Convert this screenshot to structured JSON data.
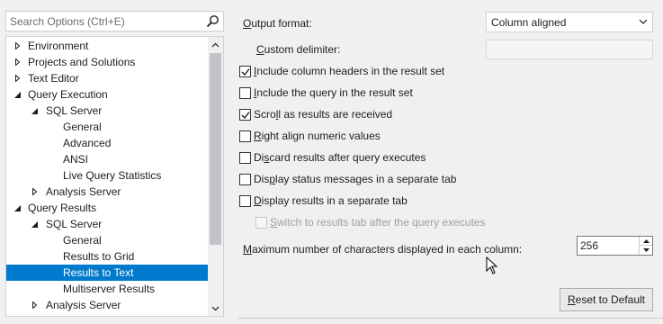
{
  "search": {
    "placeholder": "Search Options (Ctrl+E)"
  },
  "tree": [
    {
      "label": "Environment",
      "state": "collapsed",
      "level": 0,
      "selected": false
    },
    {
      "label": "Projects and Solutions",
      "state": "collapsed",
      "level": 0,
      "selected": false
    },
    {
      "label": "Text Editor",
      "state": "collapsed",
      "level": 0,
      "selected": false
    },
    {
      "label": "Query Execution",
      "state": "expanded",
      "level": 0,
      "selected": false
    },
    {
      "label": "SQL Server",
      "state": "expanded",
      "level": 1,
      "selected": false
    },
    {
      "label": "General",
      "state": "leaf",
      "level": 2,
      "selected": false
    },
    {
      "label": "Advanced",
      "state": "leaf",
      "level": 2,
      "selected": false
    },
    {
      "label": "ANSI",
      "state": "leaf",
      "level": 2,
      "selected": false
    },
    {
      "label": "Live Query Statistics",
      "state": "leaf",
      "level": 2,
      "selected": false
    },
    {
      "label": "Analysis Server",
      "state": "collapsed",
      "level": 1,
      "selected": false
    },
    {
      "label": "Query Results",
      "state": "expanded",
      "level": 0,
      "selected": false
    },
    {
      "label": "SQL Server",
      "state": "expanded",
      "level": 1,
      "selected": false
    },
    {
      "label": "General",
      "state": "leaf",
      "level": 2,
      "selected": false
    },
    {
      "label": "Results to Grid",
      "state": "leaf",
      "level": 2,
      "selected": false
    },
    {
      "label": "Results to Text",
      "state": "leaf",
      "level": 2,
      "selected": true
    },
    {
      "label": "Multiserver Results",
      "state": "leaf",
      "level": 2,
      "selected": false
    },
    {
      "label": "Analysis Server",
      "state": "collapsed",
      "level": 1,
      "selected": false
    }
  ],
  "output_format": {
    "label_mn": "O",
    "label_rest": "utput format:",
    "value": "Column aligned"
  },
  "custom_delimiter": {
    "label_mn": "C",
    "label_rest": "ustom delimiter:",
    "value": ""
  },
  "options": [
    {
      "mn": "I",
      "rest": "nclude column headers in the result set",
      "checked": true,
      "enabled": true
    },
    {
      "mn": "I",
      "rest": "nclude the query in the result set",
      "checked": false,
      "enabled": true
    },
    {
      "pre": "Scro",
      "mn": "l",
      "rest": "l as results are received",
      "checked": true,
      "enabled": true
    },
    {
      "mn": "R",
      "rest": "ight align numeric values",
      "checked": false,
      "enabled": true
    },
    {
      "pre": "Di",
      "mn": "s",
      "rest": "card results after query executes",
      "checked": false,
      "enabled": true
    },
    {
      "pre": "Dis",
      "mn": "p",
      "rest": "lay status messages in a separate tab",
      "checked": false,
      "enabled": true
    },
    {
      "mn": "D",
      "rest": "isplay results in a separate tab",
      "checked": false,
      "enabled": true
    },
    {
      "mn": "S",
      "rest": "witch to results tab after the query executes",
      "checked": false,
      "enabled": false
    }
  ],
  "max_chars": {
    "label_mn": "M",
    "label_rest": "aximum number of characters displayed in each column:",
    "value": "256"
  },
  "reset": {
    "mn": "R",
    "rest": "eset to Default"
  }
}
